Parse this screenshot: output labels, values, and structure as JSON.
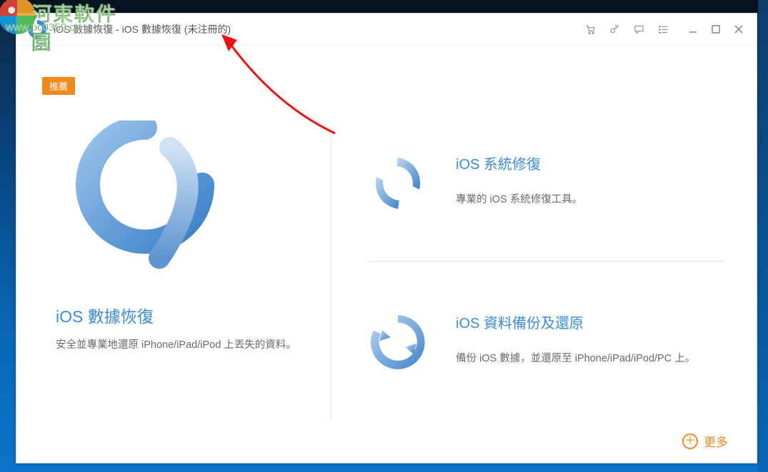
{
  "titlebar": {
    "title": "iOS 數據恢復 - iOS 數據恢復 (未注冊的)"
  },
  "badge": "推薦",
  "left_card": {
    "title": "iOS 數據恢復",
    "desc": "安全並專業地還原 iPhone/iPad/iPod 上丟失的資料。"
  },
  "right_cards": [
    {
      "title": "iOS 系統修復",
      "desc": "專業的 iOS 系統修復工具。"
    },
    {
      "title": "iOS 資料備份及還原",
      "desc": "備份 iOS 數據，並還原至 iPhone/iPad/iPod/PC 上。"
    }
  ],
  "more_label": "更多",
  "watermark": {
    "text": "河東軟件園",
    "url": "www.pc0359.cn"
  }
}
